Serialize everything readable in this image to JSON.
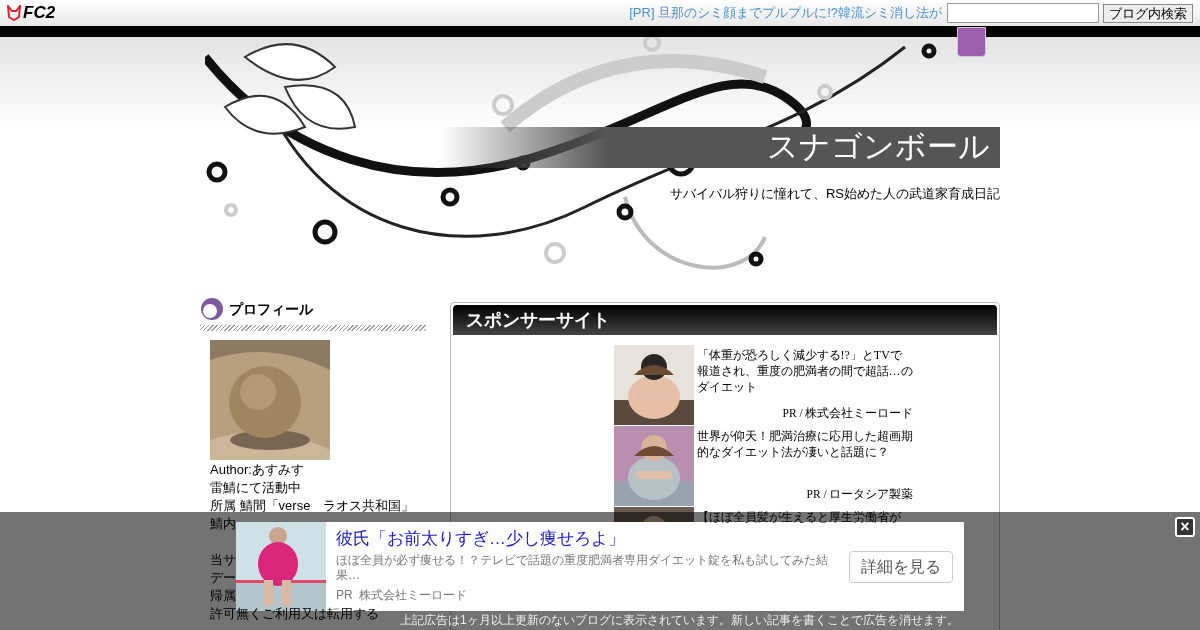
{
  "topbar": {
    "logo": "FC2",
    "pr_link": "[PR] 旦那のシミ顔までプルプルに!?韓流シミ消し法が",
    "search": {
      "button": "ブログ内検索"
    }
  },
  "blog": {
    "title": "スナゴンボール",
    "subtitle": "サバイバル狩りに憧れて、RS始めた人の武道家育成日記"
  },
  "profile": {
    "heading": "プロフィール",
    "lines": [
      "Author:あすみす",
      "雷鯖にて活動中",
      "所属 鯖間「verse　ラオス共和国」",
      "鯖内"
    ],
    "notes": [
      "当サ",
      "デー",
      "帰属",
      "許可無くご利用又は転用する"
    ]
  },
  "sponsor": {
    "heading": "スポンサーサイト",
    "ads": [
      {
        "text": "「体重が恐ろしく減少する!?」とTVで報道され、重度の肥満者の間で超話…のダイエット",
        "advertiser": "PR / 株式会社ミーロード"
      },
      {
        "text": "世界が仰天！肥満治療に応用した超画期的なダイエット法が凄いと話題に？",
        "advertiser": "PR / ロータシア製薬"
      },
      {
        "text": "【ほぼ全員髪が生えると厚生労働省が"
      }
    ]
  },
  "overlay_ad": {
    "title": "彼氏「お前太りすぎ…少し痩せろよ」",
    "description": "ほぼ全員が必ず痩せる！？テレビで話題の重度肥満者専用ダイエット錠を私も試してみた結果…",
    "advertiser": "PR  株式会社ミーロード",
    "button": "詳細を見る",
    "notice": "上記広告は1ヶ月以上更新のないブログに表示されています。新しい記事を書くことで広告を消せます。",
    "close": "×"
  }
}
